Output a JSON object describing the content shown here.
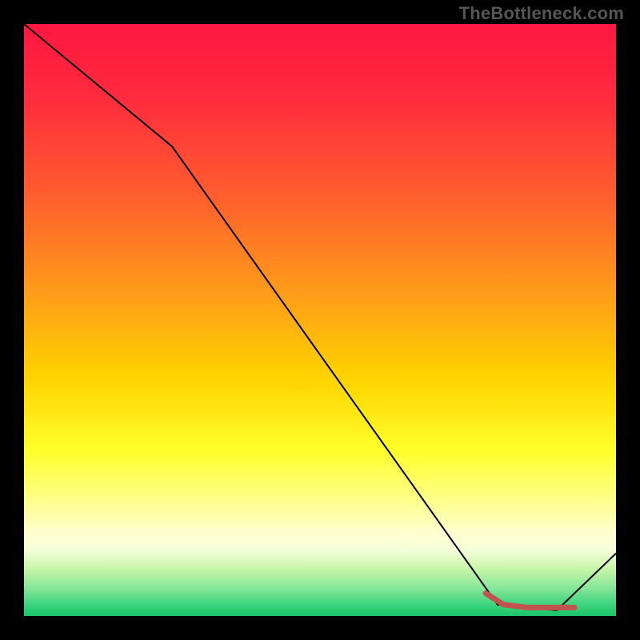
{
  "watermark": "TheBottleneck.com",
  "gradient_stops": [
    {
      "pct": 0,
      "color": "#ff1740"
    },
    {
      "pct": 12,
      "color": "#ff2a3e"
    },
    {
      "pct": 28,
      "color": "#ff5a2f"
    },
    {
      "pct": 45,
      "color": "#ff9a1a"
    },
    {
      "pct": 60,
      "color": "#ffd400"
    },
    {
      "pct": 72,
      "color": "#ffff2a"
    },
    {
      "pct": 82,
      "color": "#ffff9e"
    },
    {
      "pct": 86,
      "color": "#ffffd0"
    },
    {
      "pct": 89,
      "color": "#f5ffd8"
    },
    {
      "pct": 92,
      "color": "#c8f5a8"
    },
    {
      "pct": 95,
      "color": "#8ce89a"
    },
    {
      "pct": 98,
      "color": "#3fd47f"
    },
    {
      "pct": 100,
      "color": "#18c56a"
    }
  ],
  "chart_data": {
    "type": "line",
    "title": "",
    "xlabel": "",
    "ylabel": "",
    "xlim": [
      0,
      100
    ],
    "ylim": [
      0,
      104
    ],
    "series": [
      {
        "name": "main-curve",
        "color": "#000000",
        "width": 2,
        "x": [
          0,
          25,
          80,
          90,
          100
        ],
        "values": [
          104,
          82.5,
          2,
          1,
          11
        ]
      },
      {
        "name": "optimal-band",
        "color": "#c1544f",
        "width": 7,
        "linecap": "round",
        "x": [
          78,
          81,
          85,
          88,
          90,
          92,
          93
        ],
        "values": [
          4.0,
          2.0,
          1.5,
          1.5,
          1.5,
          1.5,
          1.5
        ]
      }
    ]
  }
}
